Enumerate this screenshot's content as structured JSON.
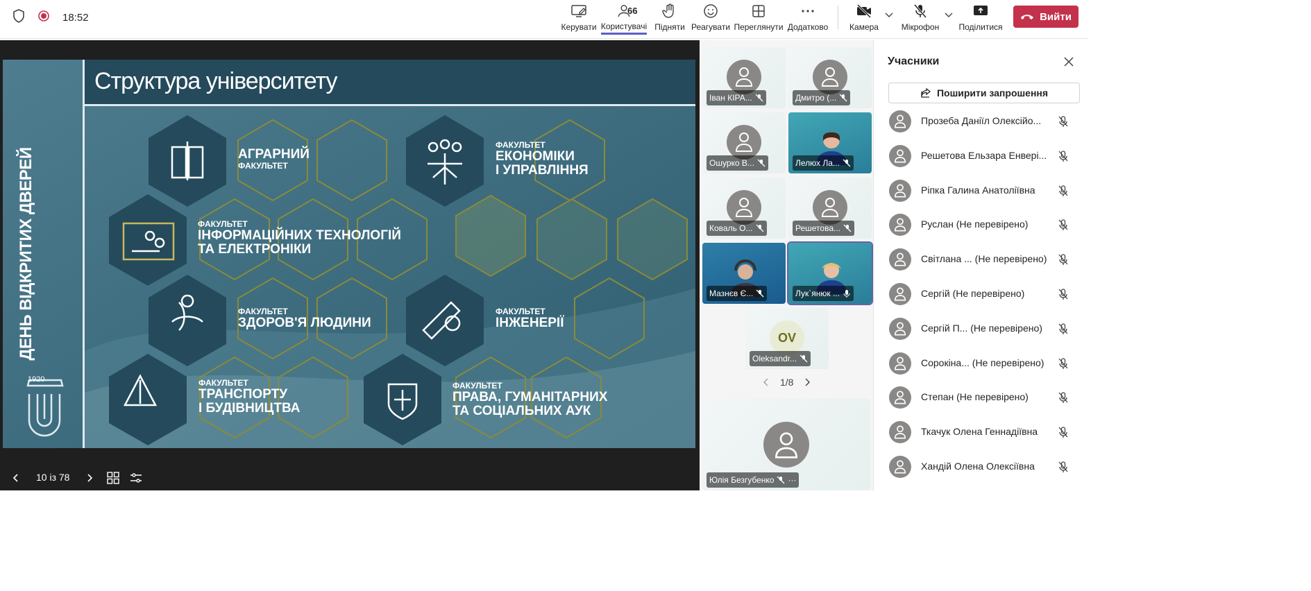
{
  "topbar": {
    "time": "18:52",
    "buttons": {
      "manage": "Керувати",
      "people": "Користувачі",
      "people_count": "66",
      "raise": "Підняти",
      "react": "Реагувати",
      "view": "Переглянути",
      "more": "Додатково",
      "camera": "Камера",
      "mic": "Мікрофон",
      "share": "Поділитися"
    },
    "leave_label": "Вийти",
    "leave_color": "#c4314b",
    "accent_color": "#5b5fc7"
  },
  "slide": {
    "title": "Структура університету",
    "vertical_text": "ДЕНЬ ВІДКРИТИХ ДВЕРЕЙ",
    "logo_year": "1920",
    "faculties": [
      {
        "small": "",
        "big1": "АГРАРНИЙ",
        "big2": "",
        "small_after": "ФАКУЛЬТЕТ"
      },
      {
        "small": "ФАКУЛЬТЕТ",
        "big1": "ЕКОНОМІКИ",
        "big2": "І УПРАВЛІННЯ"
      },
      {
        "small": "ФАКУЛЬТЕТ",
        "big1": "ІНФОРМАЦІЙНИХ ТЕХНОЛОГІЙ",
        "big2": "ТА ЕЛЕКТРОНІКИ"
      },
      {
        "small": "ФАКУЛЬТЕТ",
        "big1": "ЗДОРОВ'Я ЛЮДИНИ",
        "big2": ""
      },
      {
        "small": "ФАКУЛЬТЕТ",
        "big1": "ІНЖЕНЕРІЇ",
        "big2": ""
      },
      {
        "small": "ФАКУЛЬТЕТ",
        "big1": "ТРАНСПОРТУ",
        "big2": "І БУДІВНИЦТВА"
      },
      {
        "small": "ФАКУЛЬТЕТ",
        "big1": "ПРАВА, ГУМАНІТАРНИХ",
        "big2": "ТА СОЦІАЛЬНИХ АУК"
      }
    ]
  },
  "stagebar": {
    "page": "10 із 78"
  },
  "gallery": {
    "tiles": [
      {
        "name": "Іван КІРА..."
      },
      {
        "name": "Дмитро (..."
      },
      {
        "name": "Ошурко В..."
      },
      {
        "name": "Лелюх Ла..."
      },
      {
        "name": "Коваль О..."
      },
      {
        "name": "Решетова..."
      },
      {
        "name": "Мазнєв Є..."
      },
      {
        "name": "Лук`янюк ..."
      },
      {
        "name": "Oleksandr...",
        "initials": "OV"
      }
    ],
    "pager": "1/8",
    "self_name": "Юлія Безгубенко",
    "self_more": "···"
  },
  "panel": {
    "title": "Учасники",
    "invite_label": "Поширити запрошення",
    "participants": [
      "Прозеба Даніїл Олексійо...",
      "Решетова Ельзара Енвері...",
      "Ріпка Галина Анатоліївна",
      "Руслан (Не перевірено)",
      "Світлана ...  (Не перевірено)",
      "Сергій (Не перевірено)",
      "Сергій П...  (Не перевірено)",
      "Сорокіна...  (Не перевірено)",
      "Степан (Не перевірено)",
      "Ткачук Олена Геннадіївна",
      "Хандій Олена Олексіївна"
    ]
  }
}
